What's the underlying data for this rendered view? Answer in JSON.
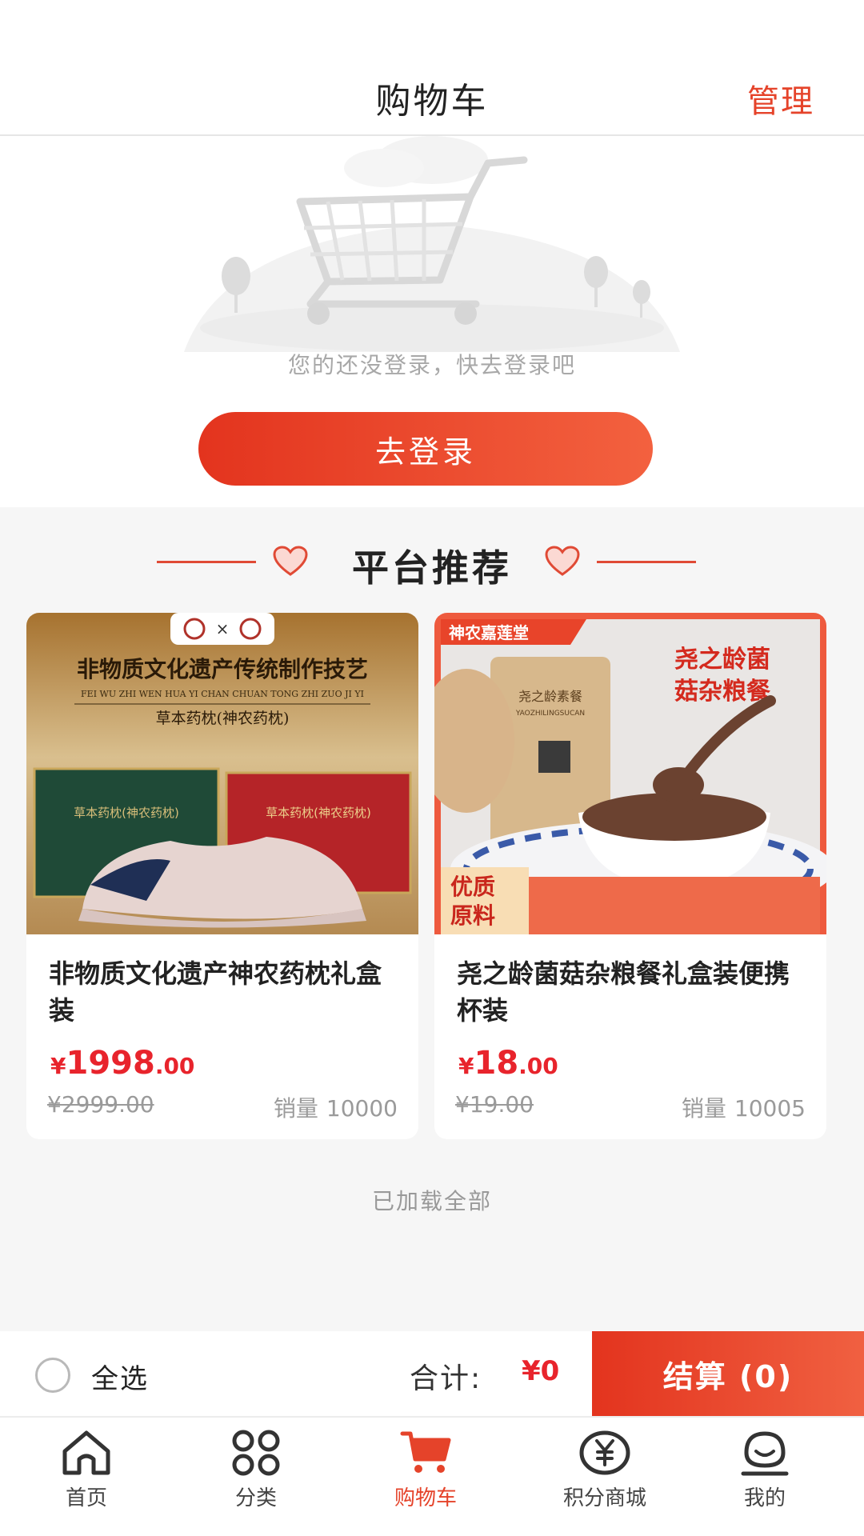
{
  "header": {
    "title": "购物车",
    "manage_label": "管理"
  },
  "empty_state": {
    "message": "您的还没登录，快去登录吧",
    "login_button": "去登录"
  },
  "recommend": {
    "title": "平台推荐",
    "products": [
      {
        "name": "非物质文化遗产神农药枕礼盒装",
        "price_symbol": "¥",
        "price_int": "1998",
        "price_dec": ".00",
        "original_price": "¥2999.00",
        "sales_label": "销量",
        "sales": "10000",
        "image": {
          "logo_x": "×",
          "headline": "非物质文化遗产传统制作技艺",
          "pinyin": "FEI WU ZHI WEN HUA YI CHAN CHUAN TONG ZHI ZUO JI YI",
          "subline": "草本药枕(神农药枕)",
          "box_left": "草本药枕(神农药枕)",
          "box_right": "草本药枕(神农药枕)"
        }
      },
      {
        "name": "尧之龄菌菇杂粮餐礼盒装便携杯装",
        "price_symbol": "¥",
        "price_int": "18",
        "price_dec": ".00",
        "original_price": "¥19.00",
        "sales_label": "销量",
        "sales": "10005",
        "image": {
          "brand": "神农嘉莲堂",
          "headline_1": "尧之龄菌",
          "headline_2": "菇杂粮餐",
          "cup_label": "尧之龄素餐",
          "cup_sub": "YAOZHILINGSUCAN",
          "badge_1": "优质",
          "badge_2": "原料"
        }
      }
    ]
  },
  "footer_note": "已加载全部",
  "checkout": {
    "select_all": "全选",
    "total_label": "合计:",
    "total_value": "¥0",
    "pay_button": "结算 (0)"
  },
  "tabs": [
    {
      "label": "首页",
      "icon": "home-icon"
    },
    {
      "label": "分类",
      "icon": "category-icon"
    },
    {
      "label": "购物车",
      "icon": "cart-icon",
      "active": true
    },
    {
      "label": "积分商城",
      "icon": "points-mall-icon"
    },
    {
      "label": "我的",
      "icon": "profile-icon"
    }
  ],
  "colors": {
    "accent": "#e5432a",
    "price": "#e8242c",
    "muted": "#9a9a9a"
  }
}
